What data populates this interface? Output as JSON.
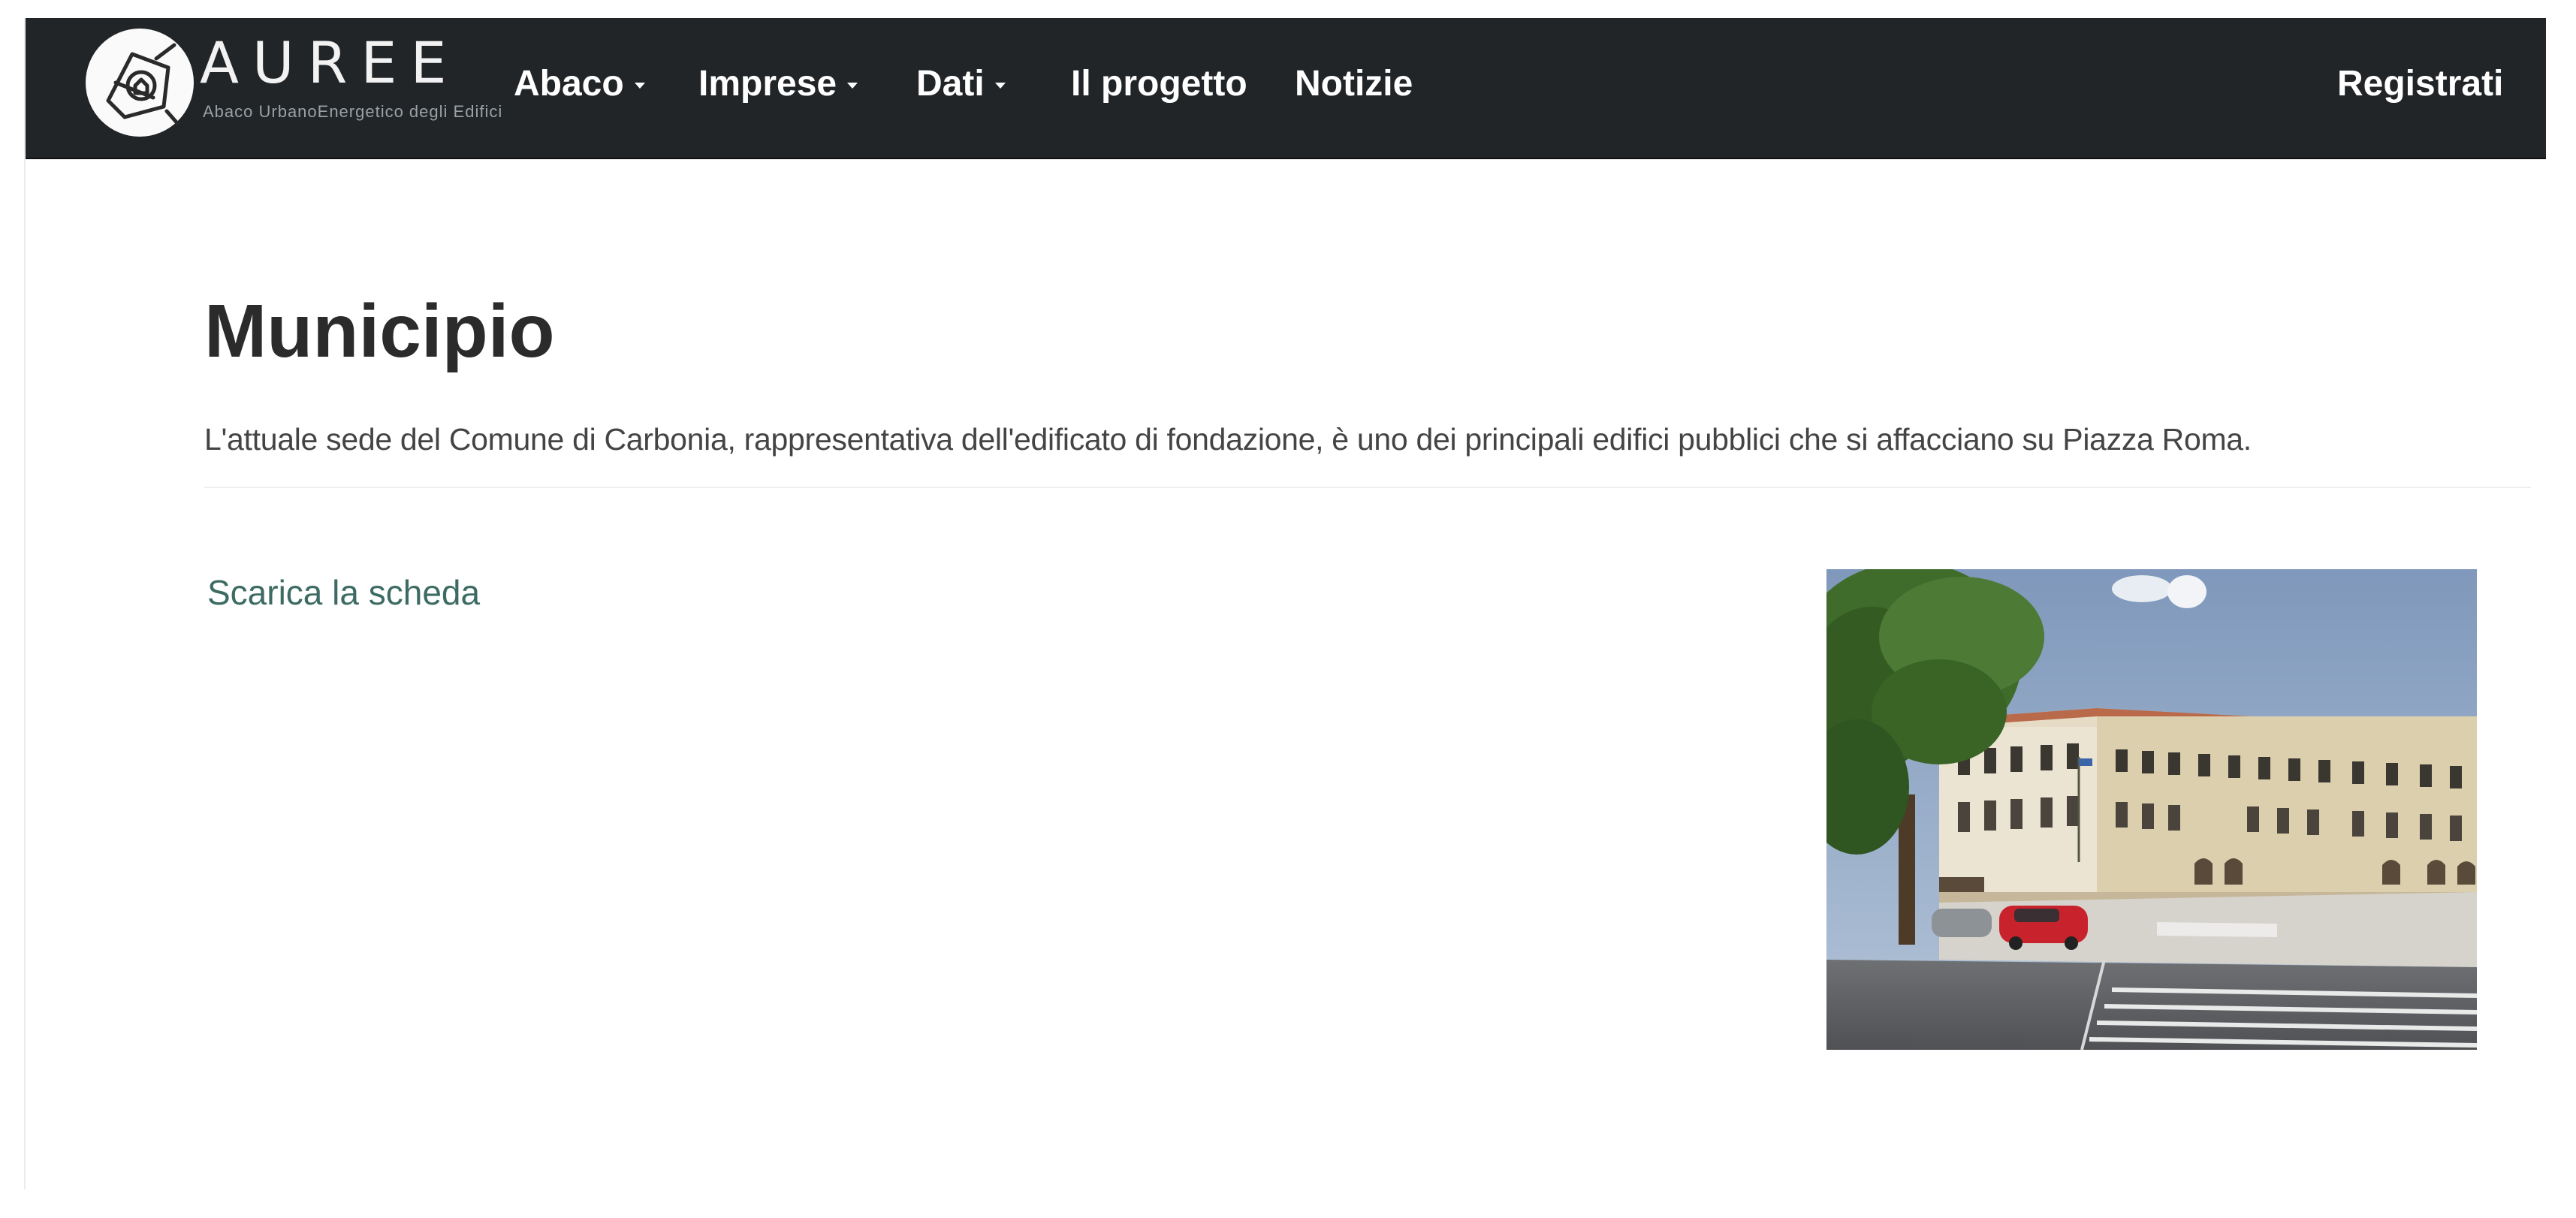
{
  "brand": {
    "title": "AUREE",
    "subtitle": "Abaco UrbanoEnergetico degli Edifici"
  },
  "nav": {
    "items": [
      {
        "label": "Abaco",
        "dropdown": true
      },
      {
        "label": "Imprese",
        "dropdown": true
      },
      {
        "label": "Dati",
        "dropdown": true
      },
      {
        "label": "Il progetto",
        "dropdown": false
      },
      {
        "label": "Notizie",
        "dropdown": false
      }
    ],
    "register_label": "Registrati"
  },
  "page": {
    "title": "Municipio",
    "description": "L'attuale sede del Comune di Carbonia, rappresentativa dell'edificato di fondazione, è uno dei principali edifici pubblici che si affacciano su Piazza Roma.",
    "download_label": "Scarica la scheda"
  },
  "colors": {
    "navbar": "#212528",
    "link": "#3d6b63",
    "title": "#2b2b2b"
  },
  "icons": {
    "logo": "leaf-house-logo-icon",
    "caret": "caret-down-icon"
  }
}
